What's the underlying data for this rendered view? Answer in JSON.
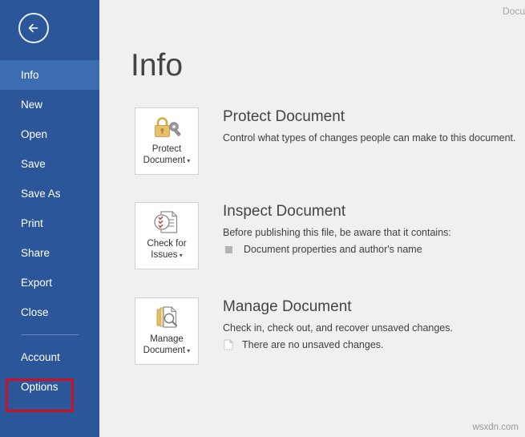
{
  "window": {
    "document_title": "Docu"
  },
  "sidebar": {
    "back_button": "back-arrow",
    "items": [
      {
        "label": "Info",
        "name": "info"
      },
      {
        "label": "New",
        "name": "new"
      },
      {
        "label": "Open",
        "name": "open"
      },
      {
        "label": "Save",
        "name": "save"
      },
      {
        "label": "Save As",
        "name": "save-as"
      },
      {
        "label": "Print",
        "name": "print"
      },
      {
        "label": "Share",
        "name": "share"
      },
      {
        "label": "Export",
        "name": "export"
      },
      {
        "label": "Close",
        "name": "close"
      }
    ],
    "bottom_items": [
      {
        "label": "Account",
        "name": "account"
      },
      {
        "label": "Options",
        "name": "options"
      }
    ],
    "active_item": "Info",
    "highlighted_item": "Options",
    "highlight_color": "#cc1122",
    "background_color": "#2b579a",
    "active_background_color": "#3c6db0"
  },
  "main": {
    "page_title": "Info",
    "sections": [
      {
        "button_label_line1": "Protect",
        "button_label_line2": "Document",
        "heading": "Protect Document",
        "description": "Control what types of changes people can make to this document.",
        "icon": "lock-and-key-icon",
        "bullets": []
      },
      {
        "button_label_line1": "Check for",
        "button_label_line2": "Issues",
        "heading": "Inspect Document",
        "description": "Before publishing this file, be aware that it contains:",
        "icon": "document-inspect-icon",
        "bullets": [
          {
            "text": "Document properties and author's name",
            "icon": "square-bullet-icon"
          }
        ]
      },
      {
        "button_label_line1": "Manage",
        "button_label_line2": "Document",
        "heading": "Manage Document",
        "description": "Check in, check out, and recover unsaved changes.",
        "icon": "document-versions-icon",
        "bullets": [
          {
            "text": "There are no unsaved changes.",
            "icon": "dotted-document-icon"
          }
        ]
      }
    ]
  },
  "watermark": "wsxdn.com"
}
